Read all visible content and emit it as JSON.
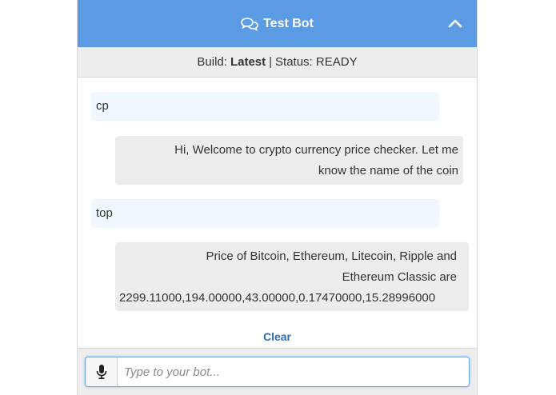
{
  "header": {
    "title": "Test Bot",
    "chat_icon": "chat-bubbles-icon",
    "collapse_icon": "chevron-up-icon",
    "background": "#5b9be3"
  },
  "status": {
    "build_prefix": "Build:",
    "build_value": "Latest",
    "separator": "|",
    "status_text": "Status: READY"
  },
  "messages": [
    {
      "from": "user",
      "text": "cp"
    },
    {
      "from": "bot",
      "lines": [
        "Hi, Welcome to crypto currency price checker. Let me",
        "know the name of the coin"
      ]
    },
    {
      "from": "user",
      "text": "top"
    },
    {
      "from": "bot",
      "lines": [
        "Price of Bitcoin, Ethereum, Litecoin, Ripple and",
        "Ethereum Classic are",
        "2299.11000,194.00000,43.00000,0.17470000,15.28996000"
      ]
    }
  ],
  "clear_label": "Clear",
  "input": {
    "placeholder": "Type to your bot...",
    "value": "",
    "mic_icon": "microphone-icon"
  }
}
